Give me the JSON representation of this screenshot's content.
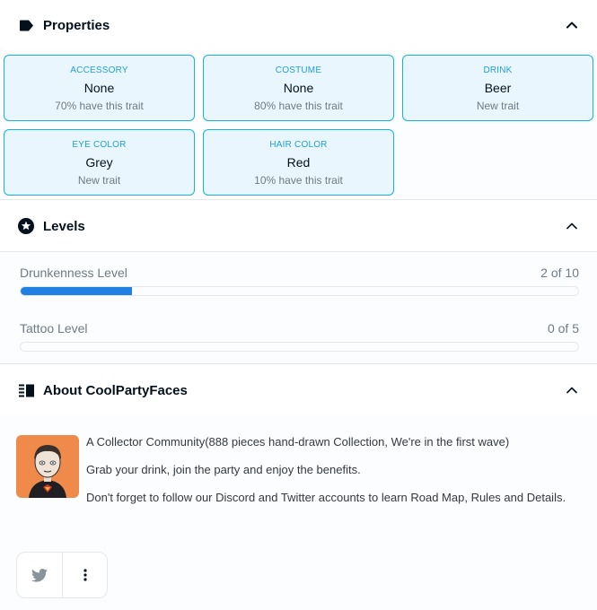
{
  "properties": {
    "title": "Properties",
    "items": [
      {
        "type": "ACCESSORY",
        "value": "None",
        "rarity": "70% have this trait"
      },
      {
        "type": "COSTUME",
        "value": "None",
        "rarity": "80% have this trait"
      },
      {
        "type": "DRINK",
        "value": "Beer",
        "rarity": "New trait"
      },
      {
        "type": "EYE COLOR",
        "value": "Grey",
        "rarity": "New trait"
      },
      {
        "type": "HAIR COLOR",
        "value": "Red",
        "rarity": "10% have this trait"
      }
    ]
  },
  "levels": {
    "title": "Levels",
    "items": [
      {
        "label": "Drunkenness Level",
        "value_text": "2 of 10",
        "current": 2,
        "max": 10
      },
      {
        "label": "Tattoo Level",
        "value_text": "0 of 5",
        "current": 0,
        "max": 5
      }
    ]
  },
  "about": {
    "title": "About CoolPartyFaces",
    "paragraphs": [
      "A Collector Community(888 pieces hand-drawn Collection, We're in the first wave)",
      "Grab your drink, join the party and enjoy the benefits.",
      "Don't forget to follow our Discord and Twitter accounts to learn Road Map, Rules and Details."
    ]
  },
  "social": {
    "buttons": [
      {
        "icon": "twitter-icon"
      },
      {
        "icon": "more-vertical-icon"
      }
    ]
  },
  "colors": {
    "accent": "#2081e2",
    "card_border": "#15b2e5",
    "card_bg": "#eaf6fd",
    "avatar_bg": "#f08a4b"
  }
}
